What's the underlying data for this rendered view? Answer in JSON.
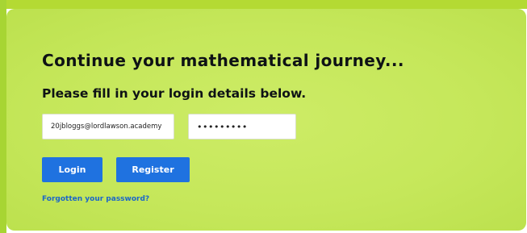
{
  "login": {
    "headline": "Continue your mathematical journey...",
    "instruction": "Please fill in your login details below.",
    "email_value": "20jbloggs@lordlawson.academy",
    "password_value": "•••••••••",
    "login_label": "Login",
    "register_label": "Register",
    "forgot_label": "Forgotten your password?"
  },
  "colors": {
    "card_background": "#c8e95f",
    "accent_button": "#1f72e0",
    "link": "#1b66c9"
  }
}
